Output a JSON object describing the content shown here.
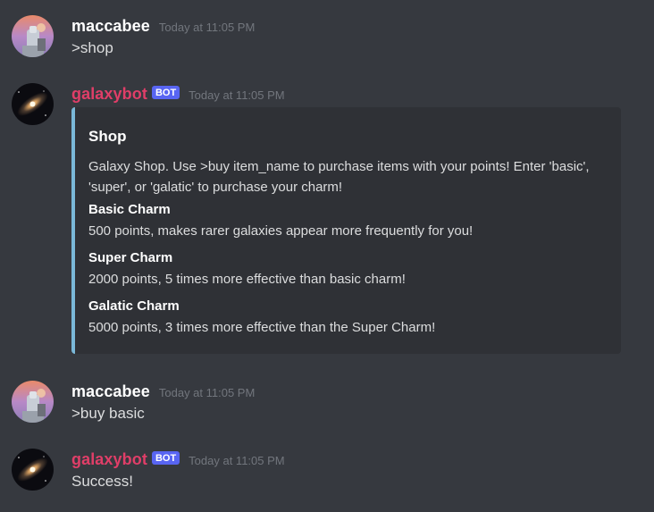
{
  "messages": [
    {
      "username": "maccabee",
      "timestamp": "Today at 11:05 PM",
      "content": ">shop"
    },
    {
      "username": "galaxybot",
      "bot_tag": "BOT",
      "timestamp": "Today at 11:05 PM",
      "embed": {
        "title": "Shop",
        "description": "Galaxy Shop. Use >buy item_name to purchase items with your points! Enter 'basic', 'super', or 'galatic' to purchase your charm!",
        "fields": [
          {
            "name": "Basic Charm",
            "value": "500 points, makes rarer galaxies appear more frequently for you!"
          },
          {
            "name": "Super Charm",
            "value": "2000 points, 5 times more effective than basic charm!"
          },
          {
            "name": "Galatic Charm",
            "value": "5000 points, 3 times more effective than the Super Charm!"
          }
        ],
        "accent_color": "#7ab8d8"
      }
    },
    {
      "username": "maccabee",
      "timestamp": "Today at 11:05 PM",
      "content": ">buy basic"
    },
    {
      "username": "galaxybot",
      "bot_tag": "BOT",
      "timestamp": "Today at 11:05 PM",
      "content": "Success!"
    }
  ],
  "colors": {
    "background": "#36393f",
    "embed_background": "#2f3136",
    "bot_username": "#e03e68",
    "bot_tag": "#5865f2",
    "timestamp": "#72767d"
  },
  "icons": {
    "user_avatar": "user-avatar-icon",
    "bot_avatar": "galaxy-avatar-icon"
  }
}
